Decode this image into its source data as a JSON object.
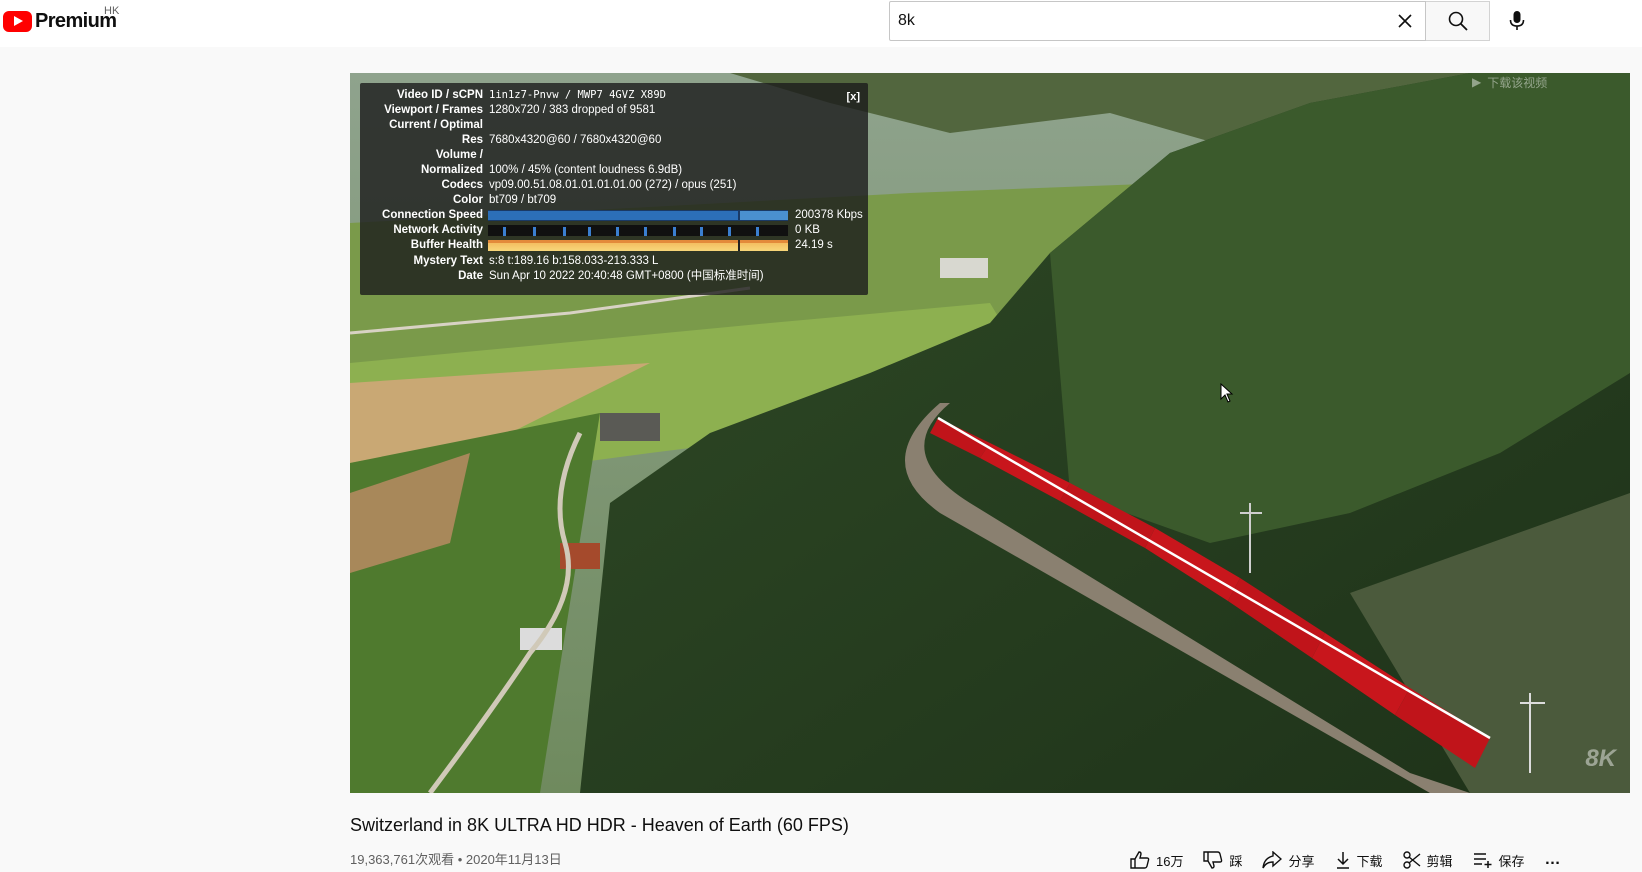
{
  "header": {
    "logo_text": "Premium",
    "region": "HK",
    "search_value": "8k",
    "brand_color": "#ff0000"
  },
  "player": {
    "stats": {
      "close_label": "[x]",
      "rows": [
        {
          "label": "Video ID / sCPN",
          "value": "1in1z7-Pnvw / MWP7 4GVZ X89D"
        },
        {
          "label": "Viewport / Frames",
          "value": "1280x720 / 383 dropped of 9581"
        },
        {
          "label": "Current / Optimal",
          "value": ""
        },
        {
          "label": "Res",
          "value": "7680x4320@60 / 7680x4320@60"
        },
        {
          "label": "Volume /",
          "value": ""
        },
        {
          "label": "Normalized",
          "value": "100% / 45% (content loudness 6.9dB)"
        },
        {
          "label": "Codecs",
          "value": "vp09.00.51.08.01.01.01.01.00 (272) / opus (251)"
        },
        {
          "label": "Color",
          "value": "bt709 / bt709"
        },
        {
          "label": "Connection Speed",
          "value": "200378 Kbps"
        },
        {
          "label": "Network Activity",
          "value": "0 KB"
        },
        {
          "label": "Buffer Health",
          "value": "24.19 s"
        },
        {
          "label": "Mystery Text",
          "value": "s:8 t:189.16 b:158.033-213.333 L"
        },
        {
          "label": "Date",
          "value": "Sun Apr 10 2022 20:40:48 GMT+0800 (中国标准时间)"
        }
      ]
    },
    "overlay_ctrl": "下载该视频",
    "watermark": "8K"
  },
  "video": {
    "title": "Switzerland in 8K ULTRA HD HDR - Heaven of Earth (60 FPS)",
    "views": "19,363,761次观看",
    "separator": "•",
    "date": "2020年11月13日"
  },
  "actions": {
    "like": "16万",
    "dislike": "踩",
    "share": "分享",
    "download": "下载",
    "clip": "剪辑",
    "save": "保存",
    "more": "…"
  }
}
